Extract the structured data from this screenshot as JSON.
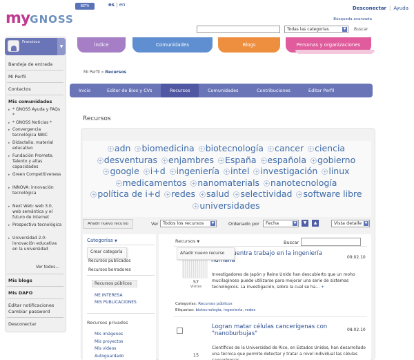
{
  "header": {
    "logo_my": "MY",
    "logo_gnoss": "GNOSS",
    "beta": "BETA",
    "lang_active": "es",
    "lang_sep": " | ",
    "lang_other": "en",
    "desconectar": "Desconectar",
    "ayuda": "Ayuda",
    "advanced_search": "Búsqueda avanzada",
    "search_placeholder": "",
    "search_category": "Todas las categorías",
    "search_button": "Buscar"
  },
  "main_tabs": [
    "Índice",
    "Comunidades",
    "Blogs",
    "Personas y organizaciones"
  ],
  "sidebar": {
    "user_name": "Francisco",
    "links": [
      "Bandeja de entrada",
      "Mi Perfil",
      "Contactos"
    ],
    "communities_title": "Mis comunidades",
    "communities": [
      "* GNOSS Ayuda y FAQs *",
      "* GNOSS Noticias *",
      "Convergencia tecnológica NBIC",
      "Didactalia: material educativo",
      "Fundación Promete. Talento y altas capacidades",
      "Green Competitiveness",
      "INNOVA: innovación tecnológica",
      "Next Web: web 3.0, web semántica y el futuro de internet",
      "Prospectiva tecnológica",
      "Universidad 2.0: innovación educativa en la universidad"
    ],
    "ver_todos": "Ver todos...",
    "mis_blogs": "Mis blogs",
    "mis_dafo": "Mis DAFO",
    "editar_notif": "Editar notificaciones",
    "cambiar_pass": "Cambiar password",
    "desconectar": "Desconectar"
  },
  "breadcrumb": {
    "parent": "Mi Perfil",
    "sep": " » ",
    "current": "Recursos"
  },
  "profile_nav": [
    "Inicio",
    "Editor de Bios y CVs",
    "Recursos",
    "Comunidades",
    "Contribuciones",
    "Editar Perfil"
  ],
  "section_title": "Recursos",
  "tags": [
    "adn",
    "biomedicina",
    "biotecnología",
    "cancer",
    "ciencia",
    "desventuras",
    "enjambres",
    "España",
    "española",
    "gobierno",
    "google",
    "i+d",
    "ingeniería",
    "intel",
    "investigación",
    "linux",
    "medicamentos",
    "nanomaterials",
    "nanotecnología",
    "política de i+d",
    "redes",
    "salud",
    "selectividad",
    "software libre",
    "universidades"
  ],
  "toolbar": {
    "add_resource": "Añadir nuevo recurso",
    "ver_label": "Ver",
    "ver_value": "Todos los recursos",
    "order_label": "Ordenado por",
    "order_value": "Fecha",
    "order_down": "▼",
    "order_up": "▲",
    "view_value": "Vista detalle"
  },
  "filters": {
    "categorias": "Categorías",
    "crear_categoria": "Crear categoría",
    "items": [
      "Recursos publicados",
      "Recursos borradores"
    ],
    "active": "Recursos públicos",
    "links": [
      "ME INTERESA",
      "MIS PUBLICACIONES"
    ],
    "private_title": "Recursos privados",
    "private_items": [
      "Mis imágenes",
      "Mis proyectos",
      "Mis vídeos",
      "Autoguardado"
    ]
  },
  "results": {
    "header": "Recursos",
    "add_popup": "Añadir nuevo recurso",
    "buscar_label": "Buscar",
    "items": [
      {
        "title": "...o encuentra trabajo en la ingeniería humana",
        "date": "09.02.10",
        "visits": "57",
        "visits_label": "Visitas",
        "description": "Investigadores de Japón y Reino Unido han descubierto que un moho mucilaginoso puede utilizarse para mejorar una serie de sistemas tecnológicos. La investigación, sobre la cual se ha...",
        "categories_label": "Categorías:",
        "categories": "Recursos públicos",
        "tags_label": "Etiquetas:",
        "tags": "biotecnología, ingeniería, redes"
      },
      {
        "title": "Logran matar células cancerígenas con \"nanoburbujas\"",
        "date": "08.02.10",
        "visits": "15",
        "visits_label": "Visitas",
        "description": "Científicos de la Universidad de Rice, en Estados Unidos, han desarrollado una técnica que permite detectar y tratar a nivel individual las células cancerígenas..."
      }
    ]
  }
}
